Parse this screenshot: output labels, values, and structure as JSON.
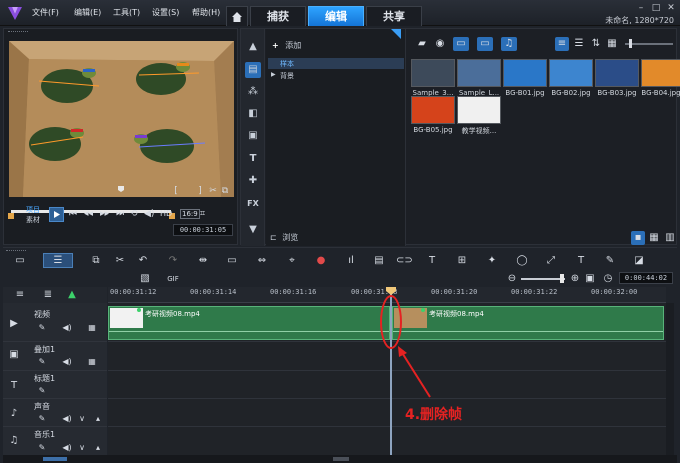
{
  "menu": {
    "file": "文件(F)",
    "edit": "编辑(E)",
    "tools": "工具(T)",
    "settings": "设置(S)",
    "help": "帮助(H)"
  },
  "tabs": {
    "capture": "捕获",
    "edit": "编辑",
    "share": "共享"
  },
  "project": {
    "title": "未命名, 1280*720"
  },
  "preview": {
    "mode_project": "项目",
    "mode_clip": "素材",
    "hd": "HD",
    "timecode": "00:00:31:05",
    "bracket_in": "[",
    "bracket_out": "]"
  },
  "library": {
    "add_label": "添加",
    "folders": [
      "样本",
      "背景"
    ],
    "browse_label": "浏览",
    "items": [
      {
        "name": "Sample_3...",
        "color": "#3d4a5a"
      },
      {
        "name": "Sample_L...",
        "color": "#4b6e9a"
      },
      {
        "name": "BG-B01.jpg",
        "color": "#2a77c8"
      },
      {
        "name": "BG-B02.jpg",
        "color": "#3d85cf"
      },
      {
        "name": "BG-B03.jpg",
        "color": "#2b4d88"
      },
      {
        "name": "BG-B04.jpg",
        "color": "#e28a2a"
      },
      {
        "name": "BG-B05.jpg",
        "color": "#d5431b"
      },
      {
        "name": "教学视频...",
        "color": "#f0f0f0"
      }
    ]
  },
  "timeline": {
    "ticks": [
      "00:00:31:12",
      "00:00:31:14",
      "00:00:31:16",
      "00:00:31:18",
      "00:00:31:20",
      "00:00:31:22",
      "00:00:32:00"
    ],
    "timecode": "0:00:44:02",
    "tracks": [
      {
        "name": "视频"
      },
      {
        "name": "叠加1"
      },
      {
        "name": "标题1"
      },
      {
        "name": "声音"
      },
      {
        "name": "音乐1"
      }
    ],
    "clip1": "考研视频08.mp4",
    "clip2": "考研视频08.mp4"
  },
  "annotation": {
    "text": "4.删除帧"
  },
  "colors": {
    "accent": "#1e8ef0",
    "clip_green": "#2f7a4a",
    "annotation_red": "#e52222"
  }
}
